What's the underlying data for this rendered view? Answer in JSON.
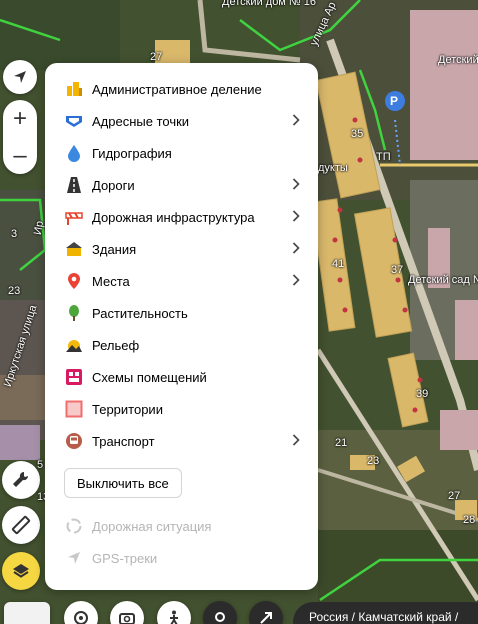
{
  "map": {
    "street_labels": [
      "улица Ар",
      "Иркутская улица",
      "Ир"
    ],
    "place_labels": [
      "Детский дом № 16",
      "Детский",
      "Детский сад №",
      "ТП",
      "дукты"
    ],
    "house_numbers": [
      "27",
      "35",
      "37",
      "41",
      "39",
      "3",
      "23",
      "21",
      "23",
      "27",
      "13",
      "28",
      "5"
    ],
    "parking_label": "P"
  },
  "controls": {
    "zoom_in": "+",
    "zoom_out": "–"
  },
  "layers_panel": {
    "items": [
      {
        "label": "Административное деление",
        "icon": "admin-division-icon",
        "color": "#f5b400",
        "has_submenu": false
      },
      {
        "label": "Адресные точки",
        "icon": "address-points-icon",
        "color": "#2b6fd6",
        "has_submenu": true
      },
      {
        "label": "Гидрография",
        "icon": "water-drop-icon",
        "color": "#3b88e0",
        "has_submenu": false
      },
      {
        "label": "Дороги",
        "icon": "road-icon",
        "color": "#333333",
        "has_submenu": true
      },
      {
        "label": "Дорожная инфраструктура",
        "icon": "barrier-icon",
        "color": "#e5432e",
        "has_submenu": true
      },
      {
        "label": "Здания",
        "icon": "building-icon",
        "color": "#f0b400",
        "has_submenu": true
      },
      {
        "label": "Места",
        "icon": "place-pin-icon",
        "color": "#ea4335",
        "has_submenu": true
      },
      {
        "label": "Растительность",
        "icon": "tree-icon",
        "color": "#4ca63a",
        "has_submenu": false
      },
      {
        "label": "Рельеф",
        "icon": "relief-icon",
        "color": "#f2b90a",
        "has_submenu": false
      },
      {
        "label": "Схемы помещений",
        "icon": "floor-plan-icon",
        "color": "#d81b60",
        "has_submenu": false
      },
      {
        "label": "Территории",
        "icon": "territory-icon",
        "color": "#f06e6e",
        "has_submenu": false
      },
      {
        "label": "Транспорт",
        "icon": "bus-icon",
        "color": "#b85c4a",
        "has_submenu": true
      }
    ],
    "disable_all_label": "Выключить все",
    "extra_items": [
      {
        "label": "Дорожная ситуация",
        "icon": "traffic-icon"
      },
      {
        "label": "GPS-треки",
        "icon": "gps-arrow-icon"
      }
    ]
  },
  "bottom_bar": {
    "breadcrumb": "Россия / Камчатский край / "
  },
  "colors": {
    "accent": "#f5d742",
    "panel_bg": "#ffffff",
    "muted_text": "#b5b5b5"
  }
}
